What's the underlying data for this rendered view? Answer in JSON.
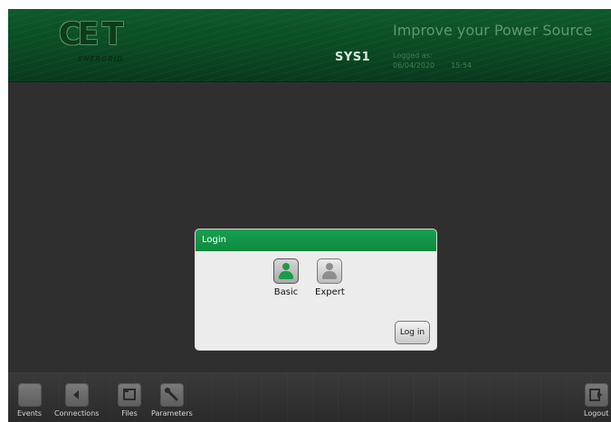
{
  "header": {
    "logo_text": "CE T",
    "logo_sub": "ENERGRID",
    "system": "SYS1",
    "tagline": "Improve your Power Source",
    "logged_label": "Logged as:",
    "date": "06/04/2020",
    "time": "15:54"
  },
  "dialog": {
    "title": "Login",
    "roles": [
      {
        "label": "Basic",
        "icon": "person-icon",
        "color": "#1b9b4a"
      },
      {
        "label": "Expert",
        "icon": "person-icon",
        "color": "#8e8e8e"
      }
    ],
    "login_button": "Log in"
  },
  "footer": {
    "tools": [
      {
        "label": "Events",
        "icon": "events-icon"
      },
      {
        "label": "Connections",
        "icon": "connections-icon"
      },
      {
        "label": "Files",
        "icon": "files-icon"
      },
      {
        "label": "Parameters",
        "icon": "wrench-icon"
      },
      {
        "label": "Logout",
        "icon": "logout-icon"
      }
    ]
  },
  "colors": {
    "header_green": "#0b4a24",
    "accent_green": "#16a050",
    "background": "#2f2f2f"
  }
}
